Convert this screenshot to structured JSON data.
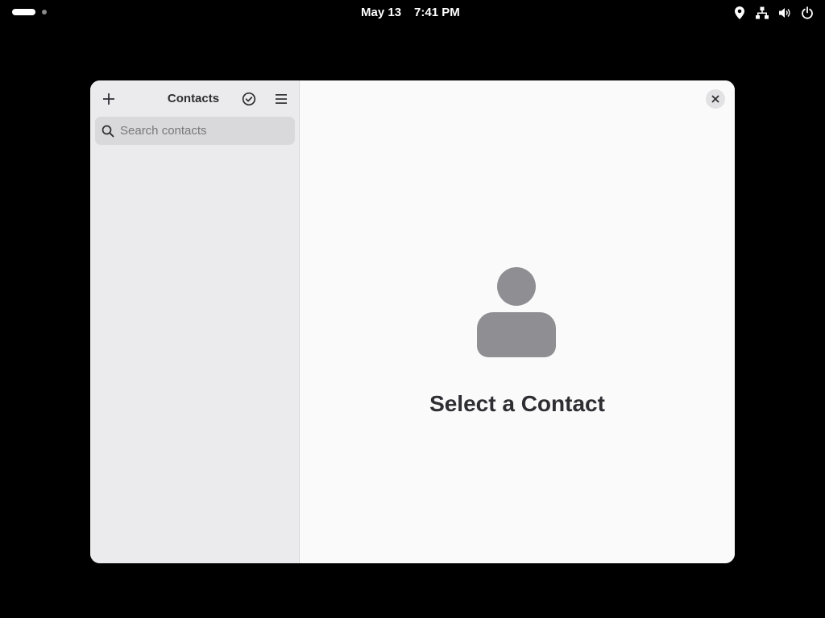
{
  "topbar": {
    "date": "May 13",
    "time": "7:41 PM",
    "tray_icons": [
      "location-icon",
      "network-icon",
      "volume-icon",
      "power-icon"
    ]
  },
  "window": {
    "sidebar": {
      "title": "Contacts",
      "add_button_icon": "plus-icon",
      "select_button_icon": "check-circle-icon",
      "menu_button_icon": "hamburger-menu-icon",
      "search": {
        "placeholder": "Search contacts",
        "value": ""
      }
    },
    "content": {
      "empty_state_icon": "person-icon",
      "empty_state_title": "Select a Contact"
    },
    "close_button_icon": "close-icon"
  },
  "colors": {
    "desktop_background": "#000000",
    "sidebar_background": "#ebebed",
    "content_background": "#fafafa",
    "placeholder_icon": "#8e8e93",
    "text": "#2e2e33"
  }
}
